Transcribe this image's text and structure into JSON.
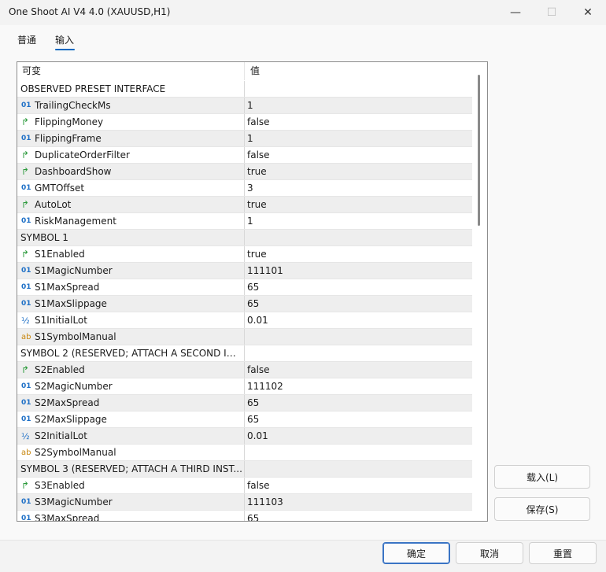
{
  "window": {
    "title": "One Shoot AI V4 4.0 (XAUUSD,H1)",
    "minimize_glyph": "—",
    "maximize_glyph": "☐",
    "close_glyph": "✕"
  },
  "tabs": [
    {
      "label": "普通"
    },
    {
      "label": "输入",
      "active": true
    }
  ],
  "grid": {
    "header": {
      "col1": "可变",
      "col2": "值"
    },
    "rows": [
      {
        "group": "OBSERVED PRESET INTERFACE"
      },
      {
        "icon": "int",
        "glyph": "01",
        "name": "TrailingCheckMs",
        "value": "1"
      },
      {
        "icon": "bool",
        "glyph": "↱",
        "name": "FlippingMoney",
        "value": "false"
      },
      {
        "icon": "int",
        "glyph": "01",
        "name": "FlippingFrame",
        "value": "1"
      },
      {
        "icon": "bool",
        "glyph": "↱",
        "name": "DuplicateOrderFilter",
        "value": "false"
      },
      {
        "icon": "bool",
        "glyph": "↱",
        "name": "DashboardShow",
        "value": "true"
      },
      {
        "icon": "int",
        "glyph": "01",
        "name": "GMTOffset",
        "value": "3"
      },
      {
        "icon": "bool",
        "glyph": "↱",
        "name": "AutoLot",
        "value": "true"
      },
      {
        "icon": "int",
        "glyph": "01",
        "name": "RiskManagement",
        "value": "1"
      },
      {
        "group": "SYMBOL 1"
      },
      {
        "icon": "bool",
        "glyph": "↱",
        "name": "S1Enabled",
        "value": "true"
      },
      {
        "icon": "int",
        "glyph": "01",
        "name": "S1MagicNumber",
        "value": "111101"
      },
      {
        "icon": "int",
        "glyph": "01",
        "name": "S1MaxSpread",
        "value": "65"
      },
      {
        "icon": "int",
        "glyph": "01",
        "name": "S1MaxSlippage",
        "value": "65"
      },
      {
        "icon": "dbl",
        "glyph": "½",
        "name": "S1InitialLot",
        "value": "0.01"
      },
      {
        "icon": "str",
        "glyph": "ab",
        "name": "S1SymbolManual",
        "value": ""
      },
      {
        "group": "SYMBOL 2 (RESERVED; ATTACH A SECOND IN..."
      },
      {
        "icon": "bool",
        "glyph": "↱",
        "name": "S2Enabled",
        "value": "false"
      },
      {
        "icon": "int",
        "glyph": "01",
        "name": "S2MagicNumber",
        "value": "111102"
      },
      {
        "icon": "int",
        "glyph": "01",
        "name": "S2MaxSpread",
        "value": "65"
      },
      {
        "icon": "int",
        "glyph": "01",
        "name": "S2MaxSlippage",
        "value": "65"
      },
      {
        "icon": "dbl",
        "glyph": "½",
        "name": "S2InitialLot",
        "value": "0.01"
      },
      {
        "icon": "str",
        "glyph": "ab",
        "name": "S2SymbolManual",
        "value": ""
      },
      {
        "group": "SYMBOL 3 (RESERVED; ATTACH A THIRD INST..."
      },
      {
        "icon": "bool",
        "glyph": "↱",
        "name": "S3Enabled",
        "value": "false"
      },
      {
        "icon": "int",
        "glyph": "01",
        "name": "S3MagicNumber",
        "value": "111103"
      },
      {
        "icon": "int",
        "glyph": "01",
        "name": "S3MaxSpread",
        "value": "65"
      }
    ]
  },
  "side_buttons": {
    "load": "载入(L)",
    "save": "保存(S)"
  },
  "footer": {
    "ok": "确定",
    "cancel": "取消",
    "reset": "重置"
  }
}
